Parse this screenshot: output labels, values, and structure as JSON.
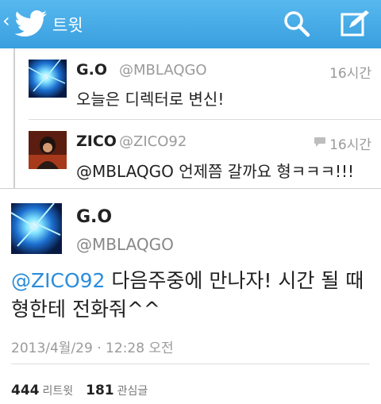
{
  "header": {
    "title": "트윗",
    "back_icon": "chevron-left-icon",
    "logo_icon": "twitter-bird-icon",
    "search_icon": "search-icon",
    "compose_icon": "compose-icon",
    "bar_color": "#4aaee8"
  },
  "conversation": [
    {
      "name": "G.O",
      "handle": "@MBLAQGO",
      "time": "16시간",
      "text": "오늘은 디렉터로 변신!"
    },
    {
      "name": "ZICO",
      "handle": "@ZICO92",
      "time": "16시간",
      "reply_icon": "speech-bubble-icon",
      "text": "@MBLAQGO 언제쯤 갈까요 형ㅋㅋㅋ!!!"
    }
  ],
  "main_tweet": {
    "name": "G.O",
    "handle": "@MBLAQGO",
    "mention": "@ZICO92",
    "text_line1": " 다음주중에 만나자! 시간 될 때",
    "text_line2": "형한테 전화줘^^",
    "date": "2013/4월/29 · 12:28 오전",
    "retweets_count": "444",
    "retweets_label": "리트윗",
    "favorites_count": "181",
    "favorites_label": "관심글"
  }
}
